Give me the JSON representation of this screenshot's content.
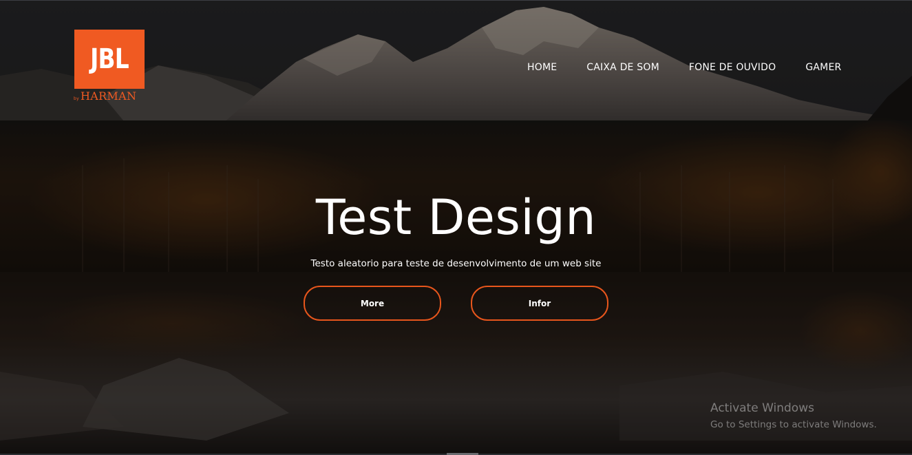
{
  "brand": {
    "logo_text": "JBL",
    "logo_by": "by",
    "logo_sub": "HARMAN",
    "accent_color": "#f05a22"
  },
  "nav": {
    "items": [
      {
        "label": "HOME"
      },
      {
        "label": "CAIXA DE SOM"
      },
      {
        "label": "FONE DE OUVIDO"
      },
      {
        "label": "GAMER"
      }
    ]
  },
  "hero": {
    "title": "Test Design",
    "subtitle": "Testo aleatorio para teste de desenvolvimento de um web site",
    "background": "mountain-lake-forest-image",
    "buttons": [
      {
        "label": "More"
      },
      {
        "label": "Infor"
      }
    ],
    "button_border_color": "#e8561c"
  },
  "watermark": {
    "title": "Activate Windows",
    "subtitle": "Go to Settings to activate Windows."
  }
}
